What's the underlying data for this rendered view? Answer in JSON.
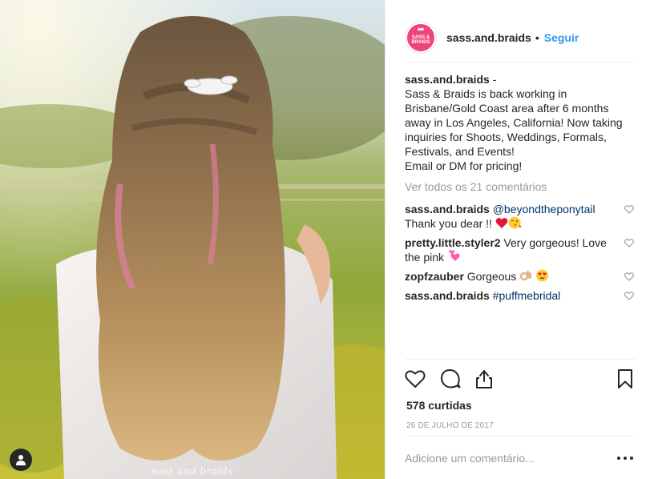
{
  "post": {
    "username": "sass.and.braids",
    "follow_label": "Seguir",
    "header_dot": "•",
    "avatar_text": [
      "SASS &",
      "BRAIDS"
    ],
    "photo_watermark": "sass and braids",
    "caption_suffix": " -",
    "caption_text": "Sass & Braids is back working in Brisbane/Gold Coast area after 6 months away in Los Angeles, California! Now taking inquiries for Shoots, Weddings, Formals, Festivals, and Events!",
    "caption_text_2": "Email or DM for pricing!",
    "view_all_comments": "Ver todos os 21 comentários",
    "comments": [
      {
        "user": "sass.and.braids",
        "mention": "@beyondtheponytail",
        "text": "Thank you dear !! ",
        "emoji": [
          "red-heart",
          "kiss-face"
        ]
      },
      {
        "user": "pretty.little.styler2",
        "text": " Very gorgeous! Love the pink ",
        "emoji": [
          "two-hearts"
        ]
      },
      {
        "user": "zopfzauber",
        "text": " Gorgeous ",
        "emoji": [
          "ok-hand",
          "heart-eyes"
        ]
      },
      {
        "user": "sass.and.braids",
        "hashtag": "#puffmebridal"
      }
    ],
    "likes": "578 curtidas",
    "date": "26 DE JULHO DE 2017",
    "comment_placeholder": "Adicione um comentário...",
    "colors": {
      "brand_pink": "#f0457a",
      "link_blue": "#3897f0",
      "mention_blue": "#003569",
      "muted": "#999999"
    }
  }
}
